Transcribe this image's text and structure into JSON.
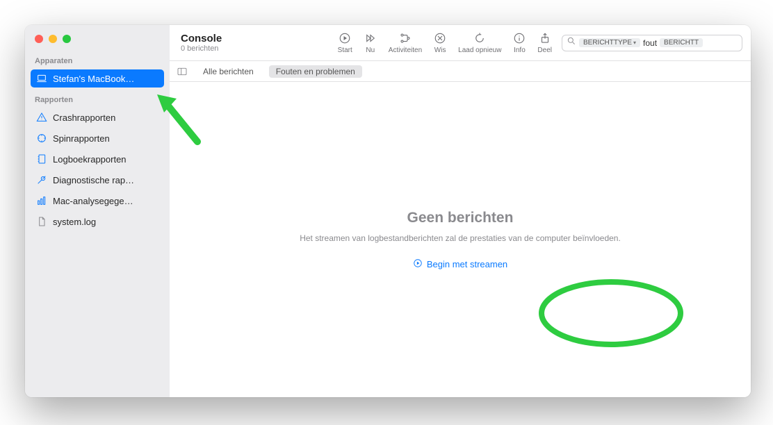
{
  "window": {
    "title": "Console",
    "subtitle": "0 berichten"
  },
  "sidebar": {
    "section_devices": "Apparaten",
    "section_reports": "Rapporten",
    "devices": [
      {
        "label": "Stefan's MacBook…"
      }
    ],
    "reports": [
      {
        "label": "Crashrapporten"
      },
      {
        "label": "Spinrapporten"
      },
      {
        "label": "Logboekrapporten"
      },
      {
        "label": "Diagnostische rap…"
      },
      {
        "label": "Mac-analysegege…"
      },
      {
        "label": "system.log"
      }
    ]
  },
  "toolbar": {
    "start": "Start",
    "now": "Nu",
    "activities": "Activiteiten",
    "clear": "Wis",
    "reload": "Laad opnieuw",
    "info": "Info",
    "share": "Deel"
  },
  "search": {
    "token_label": "BERICHTTYPE",
    "query_text": "fout",
    "trailing_token": "BERICHTT"
  },
  "filterbar": {
    "all_messages": "Alle berichten",
    "errors_problems": "Fouten en problemen"
  },
  "empty": {
    "title": "Geen berichten",
    "subtitle": "Het streamen van logbestandberichten zal de prestaties van de computer beïnvloeden.",
    "stream_button": "Begin met streamen"
  }
}
